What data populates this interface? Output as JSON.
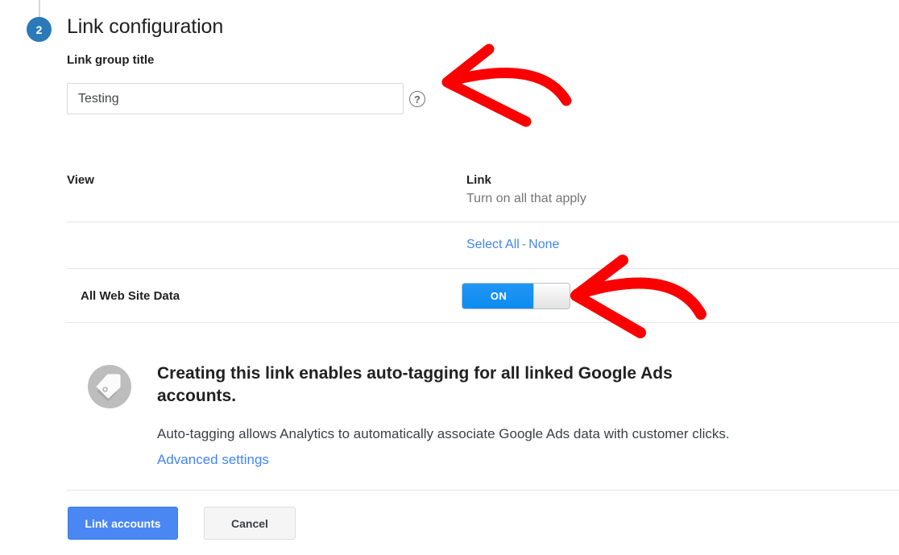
{
  "step": {
    "number": "2",
    "title": "Link configuration"
  },
  "form": {
    "group_title_label": "Link group title",
    "group_title_value": "Testing",
    "group_title_placeholder": "Link group title",
    "help_glyph": "?"
  },
  "table": {
    "col_view": "View",
    "col_link": "Link",
    "col_link_sub": "Turn on all that apply",
    "select_all": "Select All",
    "separator": "-",
    "select_none": "None",
    "rows": [
      {
        "view": "All Web Site Data",
        "toggle_state": "ON",
        "toggle_label": "ON"
      }
    ]
  },
  "info": {
    "title": "Creating this link enables auto-tagging for all linked Google Ads accounts.",
    "body": "Auto-tagging allows Analytics to automatically associate Google Ads data with customer clicks.",
    "link": "Advanced settings",
    "icon": "google-ads-tag-icon"
  },
  "actions": {
    "primary": "Link accounts",
    "secondary": "Cancel"
  },
  "annotations": [
    {
      "name": "arrow-to-link-group-title",
      "shape": "hand-drawn-left-arrow",
      "color": "#fa0000"
    },
    {
      "name": "arrow-to-link-toggle",
      "shape": "hand-drawn-left-arrow",
      "color": "#fa0000"
    }
  ],
  "colors": {
    "step_badge": "#2a7ab9",
    "link": "#4285f4",
    "toggle_on": "#1b9af7",
    "primary_button": "#4a87f3",
    "annotation": "#fa0000",
    "divider": "#e4e4e4"
  }
}
